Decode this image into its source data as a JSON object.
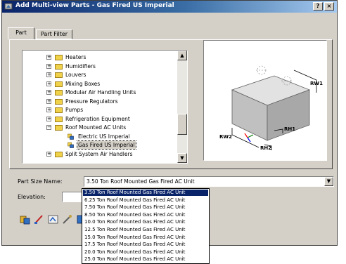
{
  "window": {
    "title": "Add Multi-view Parts - Gas Fired US Imperial",
    "help_label": "?",
    "close_label": "×"
  },
  "tabs": [
    {
      "label": "Part",
      "active": true
    },
    {
      "label": "Part Filter",
      "active": false
    }
  ],
  "tree": {
    "items": [
      {
        "label": "Heaters",
        "expander": "+"
      },
      {
        "label": "Humidifiers",
        "expander": "+"
      },
      {
        "label": "Louvers",
        "expander": "+"
      },
      {
        "label": "Mixing Boxes",
        "expander": "+"
      },
      {
        "label": "Modular Air Handling Units",
        "expander": "+"
      },
      {
        "label": "Pressure Regulators",
        "expander": "+"
      },
      {
        "label": "Pumps",
        "expander": "+"
      },
      {
        "label": "Refrigeration Equipment",
        "expander": "+"
      },
      {
        "label": "Roof Mounted AC Units",
        "expander": "−"
      },
      {
        "label": "Electric US Imperial",
        "expander": ""
      },
      {
        "label": "Gas Fired US Imperial",
        "expander": "",
        "selected": true
      },
      {
        "label": "Split System Air Handlers",
        "expander": "+"
      }
    ]
  },
  "preview": {
    "dimensions": [
      "RW1",
      "RW2",
      "RH1",
      "RH2"
    ]
  },
  "form": {
    "part_size_label": "Part Size Name:",
    "part_size_value": "3.50 Ton Roof Mounted Gas Fired AC Unit",
    "elevation_label": "Elevation:",
    "elevation_value": ""
  },
  "dropdown": {
    "options": [
      "3.50 Ton Roof Mounted Gas Fired AC Unit",
      "6.25 Ton Roof Mounted Gas Fired AC Unit",
      "7.50 Ton Roof Mounted Gas Fired AC Unit",
      "8.50 Ton Roof Mounted Gas Fired AC Unit",
      "10.0 Ton Roof Mounted Gas Fired AC Unit",
      "12.5 Ton Roof Mounted Gas Fired AC Unit",
      "15.0 Ton Roof Mounted Gas Fired AC Unit",
      "17.5 Ton Roof Mounted Gas Fired AC Unit",
      "20.0 Ton Roof Mounted Gas Fired AC Unit",
      "25.0 Ton Roof Mounted Gas Fired AC Unit"
    ],
    "selected_index": 0
  },
  "toolbar": {
    "icons": [
      "part-catalog-icon",
      "draw-icon",
      "match-icon",
      "connector-icon",
      "properties-icon"
    ]
  },
  "colors": {
    "title_start": "#0a246a",
    "title_end": "#a6caf0",
    "dialog_face": "#d4d0c8",
    "highlight": "#0a246a",
    "dimension_line": "#000000",
    "box_fill": "#c8c8c8"
  }
}
